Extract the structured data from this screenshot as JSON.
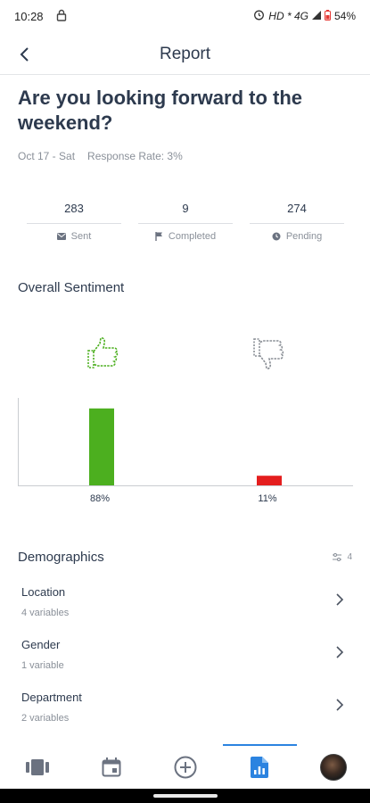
{
  "status_bar": {
    "time": "10:28",
    "network": "HD * 4G",
    "battery": "54%"
  },
  "header": {
    "title": "Report"
  },
  "question": {
    "text": "Are you looking forward to the weekend?",
    "date": "Oct 17 - Sat",
    "response_rate": "Response Rate: 3%"
  },
  "stats": [
    {
      "value": "283",
      "label": "Sent",
      "icon": "mail-icon"
    },
    {
      "value": "9",
      "label": "Completed",
      "icon": "flag-icon"
    },
    {
      "value": "274",
      "label": "Pending",
      "icon": "clock-icon"
    }
  ],
  "sentiment": {
    "title": "Overall Sentiment",
    "positive_color": "#4caf1f",
    "negative_color": "#e41e1e"
  },
  "chart_data": {
    "type": "bar",
    "categories": [
      "Positive",
      "Negative"
    ],
    "values": [
      88,
      11
    ],
    "labels": [
      "88%",
      "11%"
    ],
    "ylim": [
      0,
      100
    ],
    "colors": [
      "#4caf1f",
      "#e41e1e"
    ]
  },
  "demographics": {
    "title": "Demographics",
    "count": "4",
    "items": [
      {
        "name": "Location",
        "sub": "4 variables"
      },
      {
        "name": "Gender",
        "sub": "1 variable"
      },
      {
        "name": "Department",
        "sub": "2 variables"
      }
    ]
  },
  "nav": {
    "active": "reports",
    "accent": "#2b83e0"
  }
}
